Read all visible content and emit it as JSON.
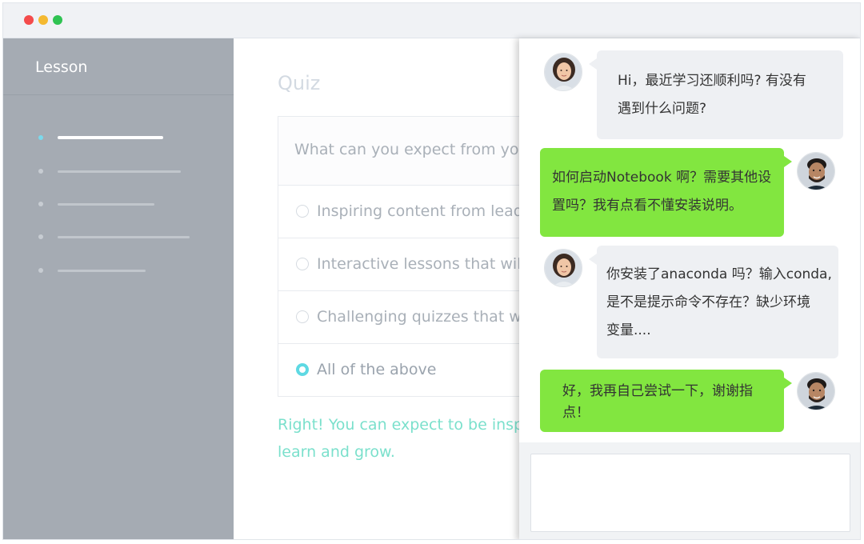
{
  "window": {
    "controls": [
      "close",
      "minimize",
      "maximize"
    ],
    "colors": {
      "close": "#f44b4b",
      "minimize": "#f4b930",
      "maximize": "#2fc352"
    }
  },
  "sidebar": {
    "title": "Lesson",
    "items_count_visible": 5,
    "active_index": 0
  },
  "quiz": {
    "title": "Quiz",
    "question": "What can you expect from your",
    "options": [
      {
        "label": "Inspiring content from leadi",
        "selected": false
      },
      {
        "label": "Interactive lessons that will c",
        "selected": false
      },
      {
        "label": "Challenging quizzes that will",
        "selected": false
      },
      {
        "label": "All of the above",
        "selected": true
      }
    ],
    "feedback_line1": "Right! You can expect to be inspire",
    "feedback_line2": "learn and grow."
  },
  "chat": {
    "messages": [
      {
        "from": "tutor",
        "line1": "Hi，最近学习还顺利吗? 有没有",
        "line2": "遇到什么问题?"
      },
      {
        "from": "student",
        "line1": "如何启动Notebook 啊？需要其他设",
        "line2": "置吗？我有点看不懂安装说明。"
      },
      {
        "from": "tutor",
        "line1": "你安装了anaconda 吗？输入conda,",
        "line2": "是不是提示命令不存在？缺少环境",
        "line3": "变量...."
      },
      {
        "from": "student",
        "line1": "好，我再自己尝试一下，谢谢指",
        "line2": "点！"
      }
    ],
    "input_placeholder": "",
    "colors": {
      "incoming_bubble": "#eef0f3",
      "outgoing_bubble": "#82e640"
    }
  },
  "colors": {
    "sidebar_bg": "#a5abb3",
    "accent_cyan": "#5ed9e3",
    "feedback_green": "#7be0cc"
  }
}
